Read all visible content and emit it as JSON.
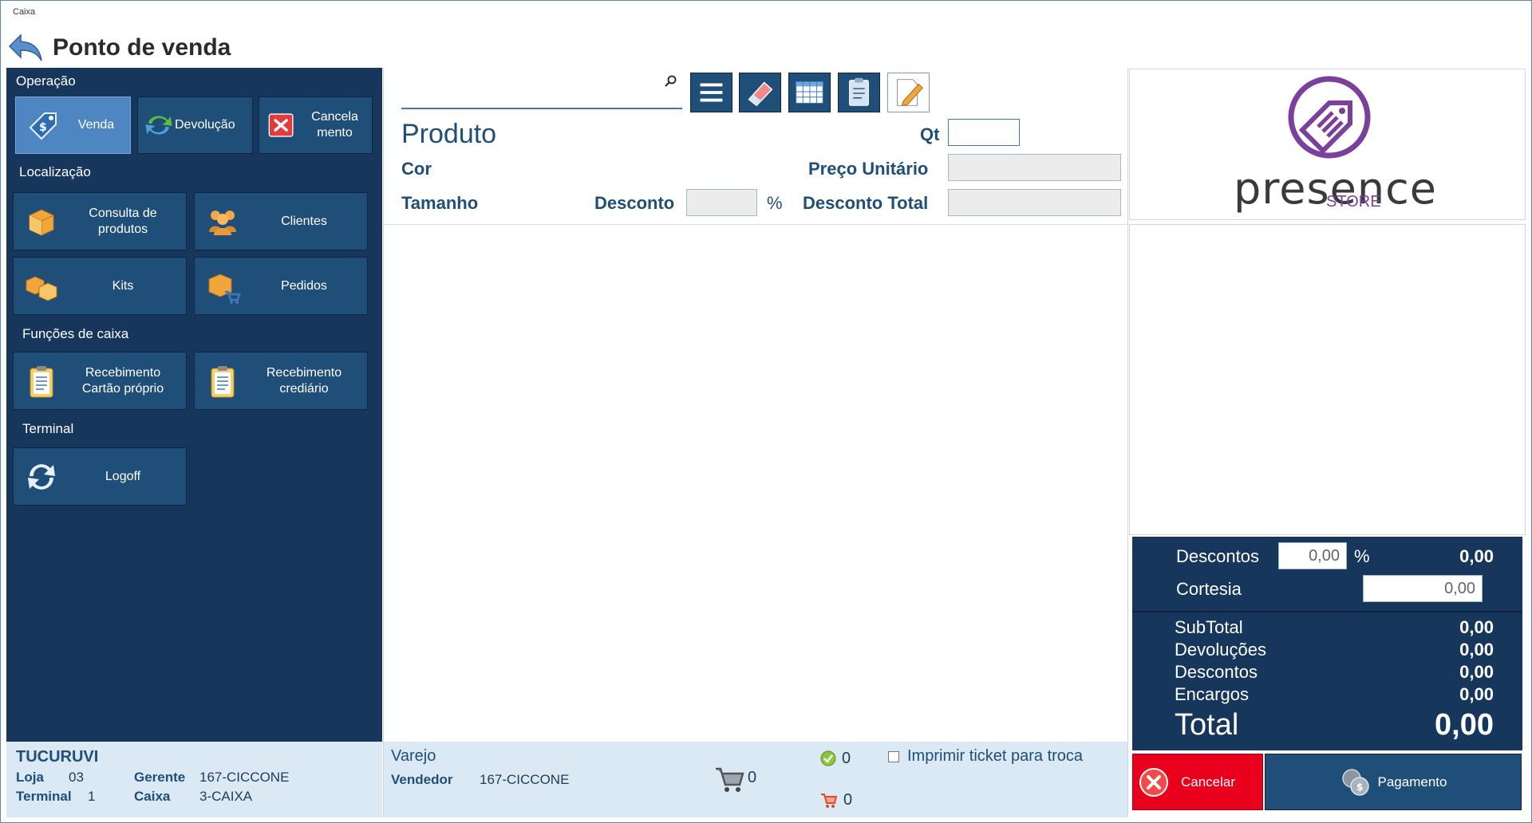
{
  "window": {
    "title": "Caixa"
  },
  "header": {
    "title": "Ponto de venda"
  },
  "sidebar": {
    "sections": {
      "operacao": "Operação",
      "localizacao": "Localização",
      "funcoes": "Funções de caixa",
      "terminal": "Terminal"
    },
    "operacao_buttons": {
      "venda": "Venda",
      "devolucao": "Devolução",
      "cancelamento_line1": "Cancela",
      "cancelamento_line2": "mento"
    },
    "localizacao_buttons": {
      "consulta_line1": "Consulta de",
      "consulta_line2": "produtos",
      "clientes": "Clientes",
      "kits": "Kits",
      "pedidos": "Pedidos"
    },
    "funcoes_buttons": {
      "rec_cartao_line1": "Recebimento",
      "rec_cartao_line2": "Cartão próprio",
      "rec_crediario_line1": "Recebimento",
      "rec_crediario_line2": "crediário"
    },
    "terminal_buttons": {
      "logoff": "Logoff"
    }
  },
  "left_status": {
    "store": "TUCURUVI",
    "loja_label": "Loja",
    "loja_value": "03",
    "gerente_label": "Gerente",
    "gerente_value": "167-CICCONE",
    "terminal_label": "Terminal",
    "terminal_value": "1",
    "caixa_label": "Caixa",
    "caixa_value": "3-CAIXA"
  },
  "product": {
    "search_value": "",
    "produto_label": "Produto",
    "qt_label": "Qt",
    "cor_label": "Cor",
    "preco_label": "Preço Unitário",
    "tamanho_label": "Tamanho",
    "desconto_label": "Desconto",
    "percent": "%",
    "desconto_total_label": "Desconto Total"
  },
  "center_status": {
    "tipo": "Varejo",
    "vendedor_label": "Vendedor",
    "vendedor_value": "167-CICCONE",
    "cart_count": "0",
    "check_count": "0",
    "cart2_count": "0",
    "print_ticket_label": "Imprimir ticket para troca"
  },
  "logo": {
    "brand": "presence",
    "sub": "STORE"
  },
  "totals": {
    "descontos_label": "Descontos",
    "descontos_input": "0,00",
    "percent": "%",
    "descontos_value": "0,00",
    "cortesia_label": "Cortesia",
    "cortesia_input": "0,00",
    "subtotal_label": "SubTotal",
    "subtotal_value": "0,00",
    "devolucoes_label": "Devoluções",
    "devolucoes_value": "0,00",
    "descontos2_label": "Descontos",
    "descontos2_value": "0,00",
    "encargos_label": "Encargos",
    "encargos_value": "0,00",
    "total_label": "Total",
    "total_value": "0,00"
  },
  "actions": {
    "cancelar": "Cancelar",
    "pagamento": "Pagamento"
  },
  "colors": {
    "navy": "#16365c",
    "tile": "#1f4e78",
    "selected": "#4d86c1",
    "cancel": "#e8001c",
    "brand": "#7b3f9c"
  }
}
